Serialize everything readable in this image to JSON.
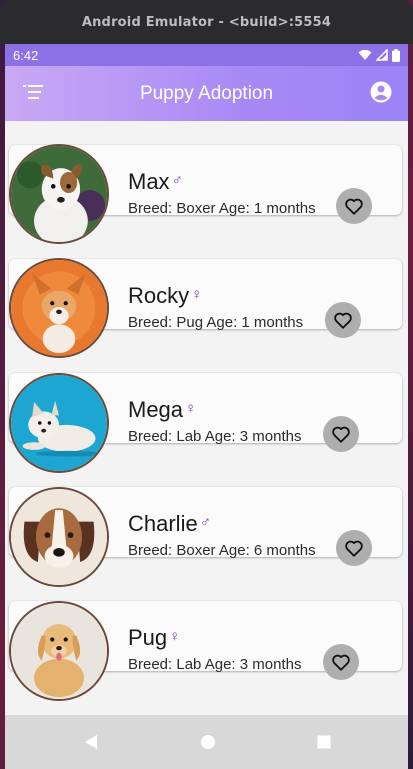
{
  "window": {
    "title": "Android Emulator - <build>:5554"
  },
  "status_bar": {
    "time": "6:42"
  },
  "app_bar": {
    "title": "Puppy Adoption"
  },
  "colors": {
    "app_bar_accent": "#a888f5",
    "gender_icon": "#7a3cc5",
    "favorite_button_bg": "#aeaeae"
  },
  "puppies": [
    {
      "name": "Max",
      "gender_symbol": "♂",
      "info": "Breed: Boxer Age: 1 months",
      "icon": "heart-outline-icon"
    },
    {
      "name": "Rocky",
      "gender_symbol": "♀",
      "info": "Breed: Pug Age: 1 months",
      "icon": "heart-outline-icon"
    },
    {
      "name": "Mega",
      "gender_symbol": "♀",
      "info": "Breed: Lab Age: 3 months",
      "icon": "heart-outline-icon"
    },
    {
      "name": "Charlie",
      "gender_symbol": "♂",
      "info": "Breed: Boxer Age: 6 months",
      "icon": "heart-outline-icon"
    },
    {
      "name": "Pug",
      "gender_symbol": "♀",
      "info": "Breed: Lab Age: 3 months",
      "icon": "heart-outline-icon"
    }
  ]
}
